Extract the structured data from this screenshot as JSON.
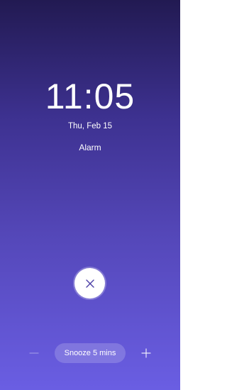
{
  "alarm": {
    "time": "11:05",
    "date": "Thu, Feb 15",
    "label": "Alarm"
  },
  "controls": {
    "dismiss_icon": "close-icon",
    "decrease_icon": "minus-icon",
    "increase_icon": "plus-icon",
    "snooze_label": "Snooze 5 mins"
  },
  "colors": {
    "background_top": "#221a52",
    "background_bottom": "#6a5ee3",
    "dismiss_button": "#ffffff",
    "dismiss_icon": "#4c3fa6"
  }
}
